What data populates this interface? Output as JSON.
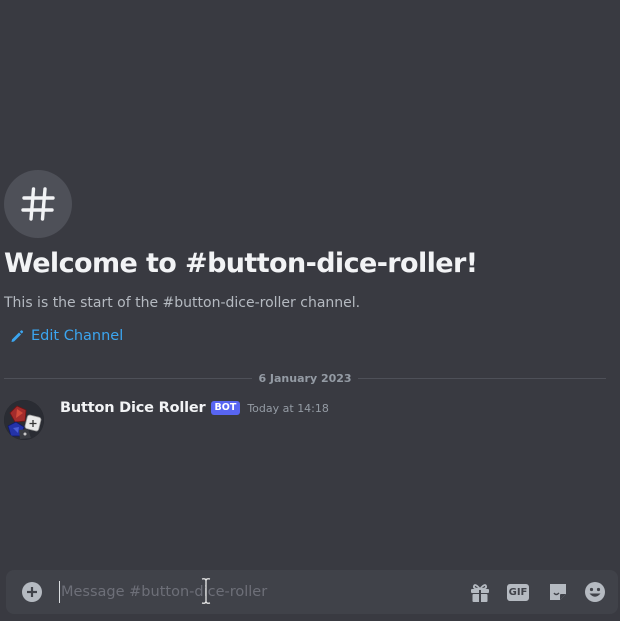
{
  "channel": {
    "icon": "hash-icon",
    "welcome_title": "Welcome to #button-dice-roller!",
    "welcome_subtitle": "This is the start of the #button-dice-roller channel.",
    "edit_label": "Edit Channel",
    "edit_icon": "pencil-icon"
  },
  "divider": {
    "date": "6 January 2023"
  },
  "message": {
    "author": "Button Dice Roller",
    "badge": "BOT",
    "timestamp": "Today at 14:18",
    "avatar_icon": "dice-avatar"
  },
  "composer": {
    "placeholder": "Message #button-dice-roller",
    "value": "",
    "icons": [
      "plus-circle-icon",
      "gift-icon",
      "gif-icon",
      "sticker-icon",
      "emoji-icon"
    ],
    "gif_label": "GIF"
  },
  "colors": {
    "background": "#393a41",
    "link": "#3ba5f0",
    "badge": "#5865f2",
    "composer": "#404249"
  }
}
